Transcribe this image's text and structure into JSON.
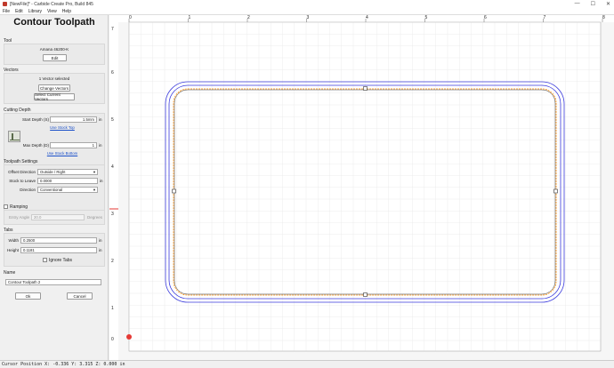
{
  "window": {
    "title": "[NewFile]* - Carbide Create Pro, Build 845",
    "minimize": "—",
    "maximize": "☐",
    "close": "✕"
  },
  "menu": [
    "File",
    "Edit",
    "Library",
    "View",
    "Help"
  ],
  "panel": {
    "title": "Contour Toolpath",
    "tool": {
      "label": "Tool",
      "name": "Amana 46200-K",
      "edit": "Edit"
    },
    "vectors": {
      "label": "Vectors",
      "selected": "1 Vector selected",
      "change": "Change Vectors",
      "select_current": "Select Current Vectors"
    },
    "cutting_depth": {
      "label": "Cutting Depth",
      "start_label": "Start Depth (S)",
      "start_value": "1.5mm",
      "unit": "in",
      "use_stock_top": "Use Stock Top",
      "max_label": "Max Depth (D)",
      "max_value": "1",
      "use_stock_bottom": "Use Stock Bottom"
    },
    "settings": {
      "label": "Toolpath Settings",
      "offset_label": "Offset Direction",
      "offset_value": "Outside / Right",
      "stock_label": "Stock to Leave",
      "stock_value": "0.0000",
      "unit": "in",
      "direction_label": "Direction",
      "direction_value": "Conventional"
    },
    "ramping": {
      "label": "Ramping",
      "entry_label": "Entry Angle",
      "entry_value": "20.0",
      "entry_unit": "Degrees"
    },
    "tabs": {
      "label": "Tabs",
      "width_label": "Width",
      "width_value": "0.2500",
      "height_label": "Height",
      "height_value": "0.1181",
      "unit": "in",
      "ignore": "Ignore Tabs"
    },
    "name": {
      "label": "Name",
      "value": "Contour Toolpath 2"
    },
    "ok": "Ok",
    "cancel": "Cancel"
  },
  "ruler": {
    "top": [
      "0",
      "1",
      "2",
      "3",
      "4",
      "5",
      "6",
      "7",
      "8"
    ],
    "left": [
      "7",
      "6",
      "5",
      "4",
      "3",
      "2",
      "1",
      "0"
    ]
  },
  "status": "Cursor Position X: -0.336 Y: 3.315 Z: 0.000 in",
  "colors": {
    "outer_path": "#3b3bdc",
    "inner_path": "#ff8a00",
    "vector": "#333333",
    "axis": "#e53935"
  }
}
